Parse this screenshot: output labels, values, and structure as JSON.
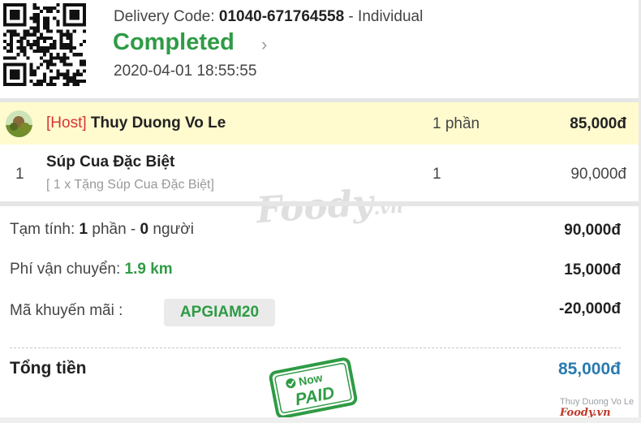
{
  "header": {
    "delivery_label": "Delivery Code: ",
    "delivery_code": "01040-671764558",
    "delivery_type": " - Individual",
    "status": "Completed",
    "datetime": "2020-04-01 18:55:55"
  },
  "host": {
    "tag": "[Host]",
    "name": "Thuy Duong Vo Le",
    "qty": "1 phần",
    "price": "85,000đ"
  },
  "item": {
    "index": "1",
    "name": "Súp Cua Đặc Biệt",
    "note": "[ 1 x Tặng Súp Cua Đặc Biệt]",
    "qty": "1",
    "price": "90,000đ"
  },
  "summary": {
    "subtotal_prefix": "Tạm tính: ",
    "subtotal_items": "1",
    "subtotal_mid": " phần - ",
    "subtotal_people": "0",
    "subtotal_suffix": " người",
    "subtotal_value": "90,000đ",
    "shipping_label": "Phí vận chuyển: ",
    "shipping_distance": "1.9 km",
    "shipping_value": "15,000đ",
    "promo_label": "Mã khuyến mãi :",
    "promo_code": "APGIAM20",
    "promo_value": "-20,000đ",
    "total_label": "Tổng tiền",
    "total_value": "85,000đ"
  },
  "stamp": {
    "top": "Now",
    "main": "PAID"
  },
  "watermark": {
    "brand": "Foody",
    "suffix": ".vn"
  },
  "corner": {
    "name": "Thuy Duong Vo Le",
    "logo": "Foody.vn"
  },
  "colors": {
    "status_green": "#2f9b45",
    "host_red": "#d93434",
    "total_blue": "#2a7bb0",
    "host_row_bg": "#fffbcf"
  },
  "icons": {
    "status_chevron": "chevron-right-icon",
    "qr": "qr-code-icon",
    "avatar": "host-avatar",
    "stamp": "paid-stamp-icon"
  }
}
